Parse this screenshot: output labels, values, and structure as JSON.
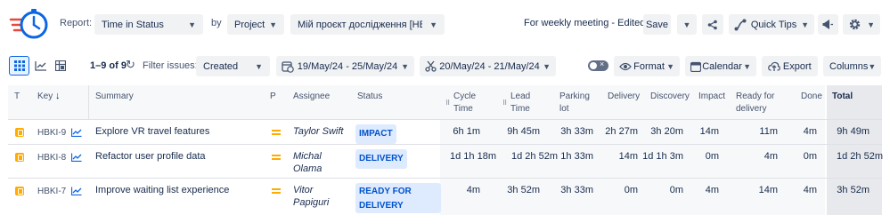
{
  "toolbar": {
    "report_label": "Report:",
    "report_value": "Time in Status",
    "by_label": "by",
    "by_value": "Project",
    "project_value": "Мій проєкт дослідження [НВ...",
    "meeting_title": "For weekly meeting - Edited",
    "save_label": "Save",
    "quick_tips_label": "Quick Tips"
  },
  "filters": {
    "pagination": "1–9 of 9",
    "filter_label": "Filter issues:",
    "filter_value": "Created",
    "date_range_1": "19/May/24 - 25/May/24",
    "date_range_2": "20/May/24 - 21/May/24",
    "format_label": "Format",
    "calendar_label": "Calendar",
    "export_label": "Export",
    "columns_label": "Columns"
  },
  "table": {
    "headers": {
      "type": "T",
      "key": "Key",
      "summary": "Summary",
      "priority": "P",
      "assignee": "Assignee",
      "status": "Status",
      "cycle_time_1": "Cycle",
      "cycle_time_2": "Time",
      "lead_time_1": "Lead",
      "lead_time_2": "Time",
      "parking_lot_1": "Parking",
      "parking_lot_2": "lot",
      "delivery": "Delivery",
      "discovery": "Discovery",
      "impact": "Impact",
      "ready_1": "Ready for",
      "ready_2": "delivery",
      "done": "Done",
      "total": "Total"
    },
    "rows": [
      {
        "key": "HBKI-9",
        "summary": "Explore VR travel features",
        "assignee_1": "Taylor Swift",
        "assignee_2": "",
        "status_1": "IMPACT",
        "status_2": "",
        "cycle_time": "6h 1m",
        "lead_time": "9h 45m",
        "parking_lot": "3h 33m",
        "delivery": "2h 27m",
        "discovery": "3h 20m",
        "impact": "14m",
        "ready": "11m",
        "done": "4m",
        "total": "9h 49m"
      },
      {
        "key": "HBKI-8",
        "summary": "Refactor user profile data",
        "assignee_1": "Michal",
        "assignee_2": "Olama",
        "status_1": "DELIVERY",
        "status_2": "",
        "cycle_time": "1d 1h 18m",
        "lead_time": "1d 2h 52m",
        "parking_lot": "1h 33m",
        "delivery": "14m",
        "discovery": "1d 1h 3m",
        "impact": "0m",
        "ready": "4m",
        "done": "0m",
        "total": "1d 2h 52m"
      },
      {
        "key": "HBKI-7",
        "summary": "Improve waiting list experience",
        "assignee_1": "Vitor",
        "assignee_2": "Papiguri",
        "status_1": "READY FOR",
        "status_2": "DELIVERY",
        "cycle_time": "4m",
        "lead_time": "3h 52m",
        "parking_lot": "3h 33m",
        "delivery": "0m",
        "discovery": "0m",
        "impact": "4m",
        "ready": "14m",
        "done": "4m",
        "total": "3h 52m"
      }
    ]
  }
}
